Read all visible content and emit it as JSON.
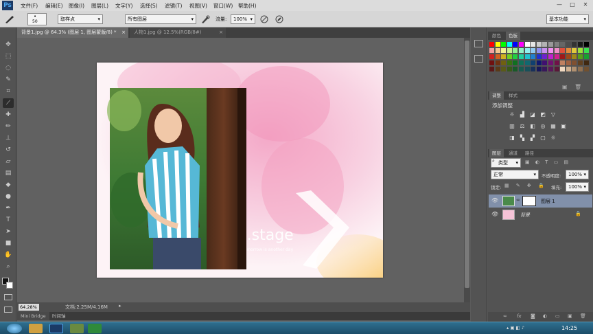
{
  "app": {
    "logo": "Ps",
    "accent_color": "#1b3a66"
  },
  "menu": [
    "文件(F)",
    "编辑(E)",
    "图像(I)",
    "图层(L)",
    "文字(Y)",
    "选择(S)",
    "滤镜(T)",
    "视图(V)",
    "窗口(W)",
    "帮助(H)"
  ],
  "window_controls": {
    "minimize": "—",
    "maximize": "□",
    "close": "✕"
  },
  "options": {
    "brush_size": "50",
    "sample_size_label": "取样点",
    "sample_layers": "所有图层",
    "flow_label": "流量:",
    "flow_value": "100%",
    "workspace": "基本功能"
  },
  "doc_tabs": [
    {
      "label": "背景1.jpg @ 64.3% (图层 1, 图层蒙版/8) *",
      "close": "×",
      "active": true
    },
    {
      "label": "人物1.jpg @ 12.5%(RGB/8#)",
      "close": "×",
      "active": false
    }
  ],
  "tools": [
    "move-tool",
    "marquee-tool",
    "lasso-tool",
    "quick-select-tool",
    "crop-tool",
    "eyedropper-tool",
    "healing-tool",
    "brush-tool",
    "clone-stamp-tool",
    "history-brush-tool",
    "eraser-tool",
    "gradient-tool",
    "blur-tool",
    "dodge-tool",
    "pen-tool",
    "type-tool",
    "path-select-tool",
    "shape-tool",
    "hand-tool",
    "zoom-tool"
  ],
  "status": {
    "zoom": "64.28%",
    "doc_info": "文档:2.25M/4.16M"
  },
  "bottom_tabs": [
    "Mini Bridge",
    "时间轴"
  ],
  "canvas_text": {
    "stage": "t.stage",
    "subline": "Tomorrow is another day"
  },
  "panels": {
    "color_tabs": [
      "颜色",
      "色板"
    ],
    "adjust_tabs": [
      "调整",
      "样式"
    ],
    "adjust_title": "添加调整",
    "layers_tabs": [
      "图层",
      "通道",
      "路径"
    ],
    "filter_kind": "类型",
    "blend_mode": "正常",
    "opacity_label": "不透明度:",
    "opacity_value": "100%",
    "lock_label": "锁定:",
    "fill_label": "填充:",
    "fill_value": "100%",
    "layers": [
      {
        "name": "图层 1",
        "selected": true
      },
      {
        "name": "背景",
        "selected": false
      }
    ],
    "footer_icons": [
      "link-icon",
      "fx-icon",
      "mask-icon",
      "adjustment-icon",
      "folder-icon",
      "new-layer-icon",
      "trash-icon"
    ]
  },
  "swatch_colors": [
    "#ff0000",
    "#ffff00",
    "#00ff00",
    "#00ffff",
    "#0000ff",
    "#ff00ff",
    "#ffffff",
    "#e6e6e6",
    "#cccccc",
    "#b3b3b3",
    "#999999",
    "#808080",
    "#666666",
    "#4d4d4d",
    "#333333",
    "#1a1a1a",
    "#000000",
    "#f2a0a0",
    "#f2c690",
    "#f2f090",
    "#c8f090",
    "#90f090",
    "#90f0c8",
    "#90f0f0",
    "#90c8f0",
    "#9090f0",
    "#c890f0",
    "#f090f0",
    "#f090c8",
    "#e0503c",
    "#e08a3c",
    "#e0c83c",
    "#9ce03c",
    "#3ce050",
    "#d02020",
    "#d06020",
    "#d0b020",
    "#70d020",
    "#20d040",
    "#20d0a0",
    "#20c0d0",
    "#2080d0",
    "#2030d0",
    "#7020d0",
    "#c020d0",
    "#d02090",
    "#a01818",
    "#a04818",
    "#a08818",
    "#58a018",
    "#18a030",
    "#701010",
    "#703010",
    "#706010",
    "#3a7010",
    "#107020",
    "#107058",
    "#106870",
    "#104070",
    "#101870",
    "#401070",
    "#701070",
    "#701048",
    "#c08060",
    "#a06040",
    "#805030",
    "#604020",
    "#402810",
    "#5a1818",
    "#5a3a18",
    "#5a5a18",
    "#385a18",
    "#185a28",
    "#185a50",
    "#18505a",
    "#18305a",
    "#18185a",
    "#38185a",
    "#5a1858",
    "#5a1838",
    "#f0d8c0",
    "#d0b090",
    "#b09070",
    "#907050",
    "#705030"
  ],
  "taskbar": {
    "time": "14:25"
  }
}
